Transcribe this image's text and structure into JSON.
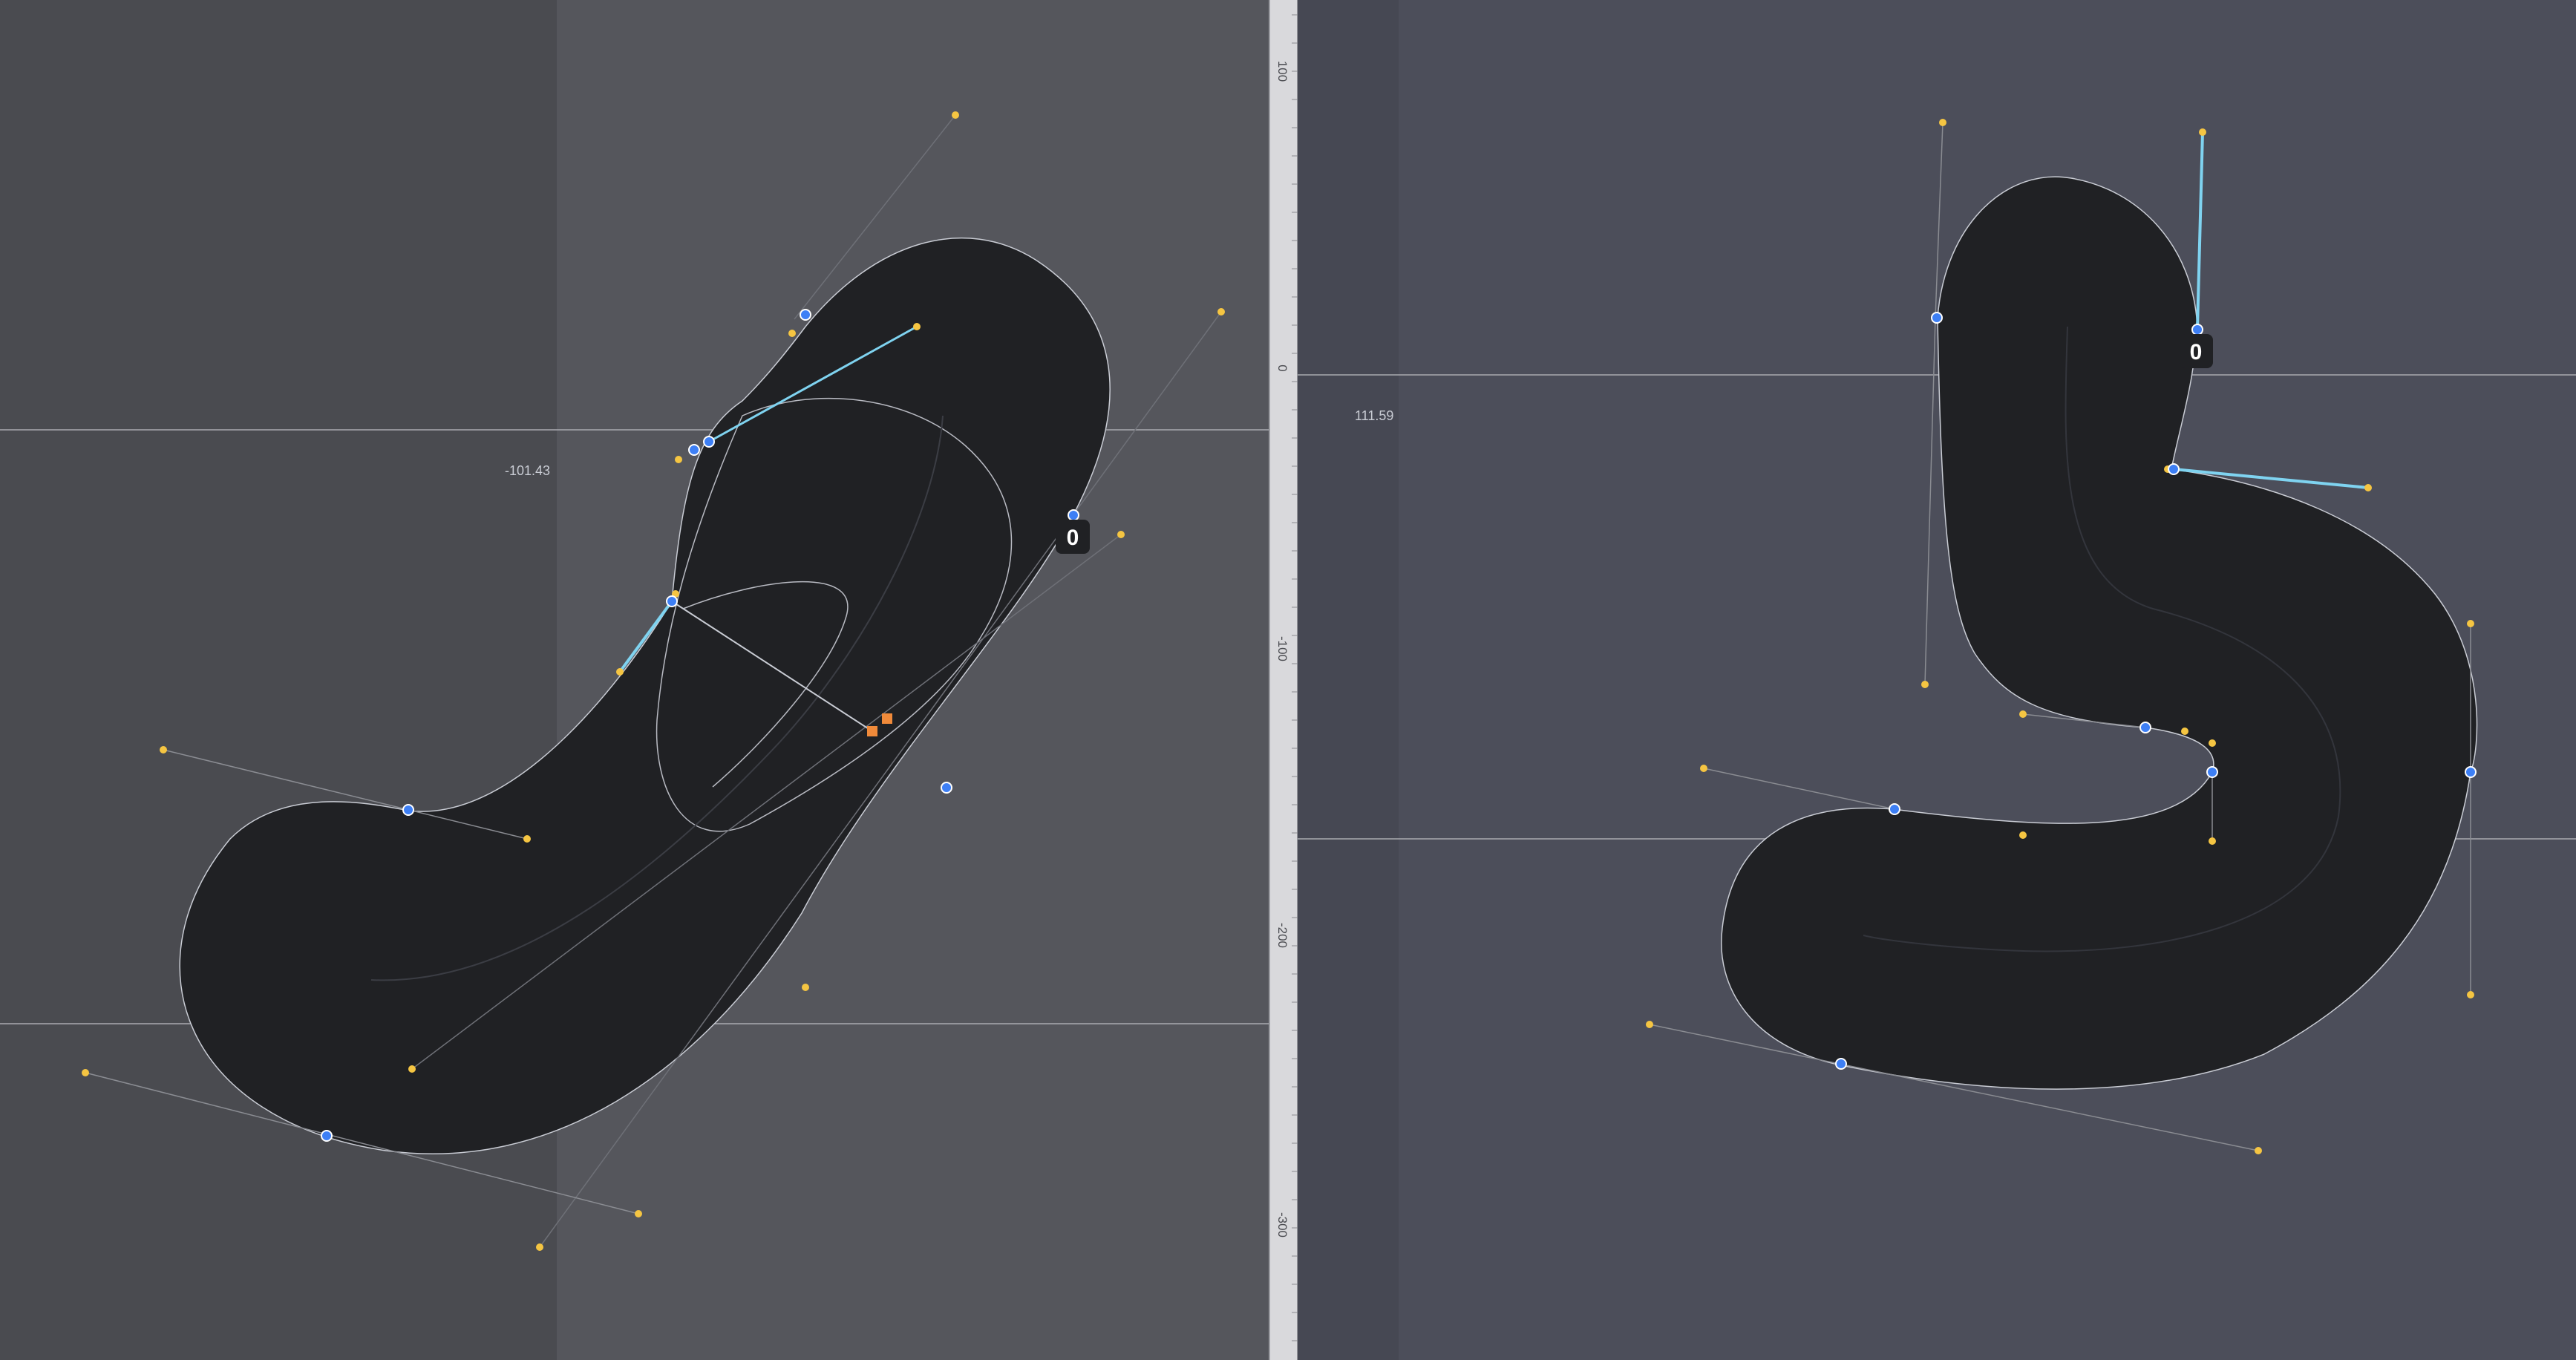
{
  "left_panel": {
    "measurement_label": "-101.43",
    "point_badge": "0"
  },
  "right_panel": {
    "measurement_label": "111.59",
    "point_badge": "0"
  },
  "ruler": {
    "ticks": [
      "100",
      "0",
      "-100",
      "-200",
      "-300"
    ]
  },
  "colors": {
    "canvas_bg": "#55565c",
    "canvas_margin": "#4a4b50",
    "right_canvas_bg": "#4c4e5a",
    "glyph_fill": "#202124",
    "on_curve_point": "#3d7ff5",
    "off_curve_point": "#f5c542",
    "selected_handle": "#7fd3f0",
    "anchor_orange": "#f08a3a",
    "ruler_bg": "#d9d9dc"
  }
}
